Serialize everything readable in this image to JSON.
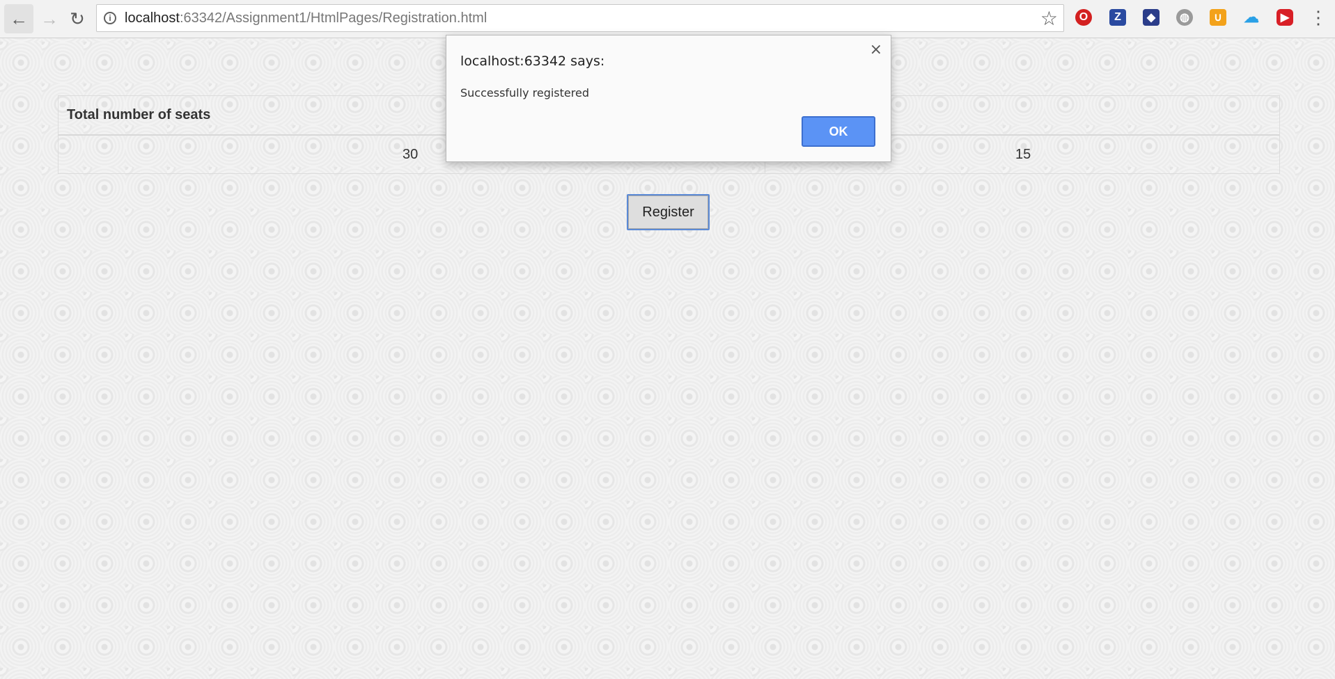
{
  "browser": {
    "url_host": "localhost",
    "url_rest": ":63342/Assignment1/HtmlPages/Registration.html",
    "icons": {
      "back": "←",
      "forward": "→",
      "reload": "↻",
      "info": "i",
      "star": "☆",
      "menu": "⋮"
    },
    "extensions": [
      {
        "name": "opera-icon",
        "glyph": "O"
      },
      {
        "name": "zotero-icon",
        "glyph": "Z"
      },
      {
        "name": "app-icon",
        "glyph": "◆"
      },
      {
        "name": "globe-icon",
        "glyph": "◍"
      },
      {
        "name": "honey-icon",
        "glyph": "∪"
      },
      {
        "name": "cloud-icon",
        "glyph": "☁"
      },
      {
        "name": "youtube-icon",
        "glyph": "▶"
      }
    ]
  },
  "table": {
    "header": "Total number of seats",
    "value_1": "30",
    "value_2": "15"
  },
  "register_button": "Register",
  "alert": {
    "title": "localhost:63342 says:",
    "message": "Successfully registered",
    "ok_label": "OK",
    "close_glyph": "×"
  }
}
